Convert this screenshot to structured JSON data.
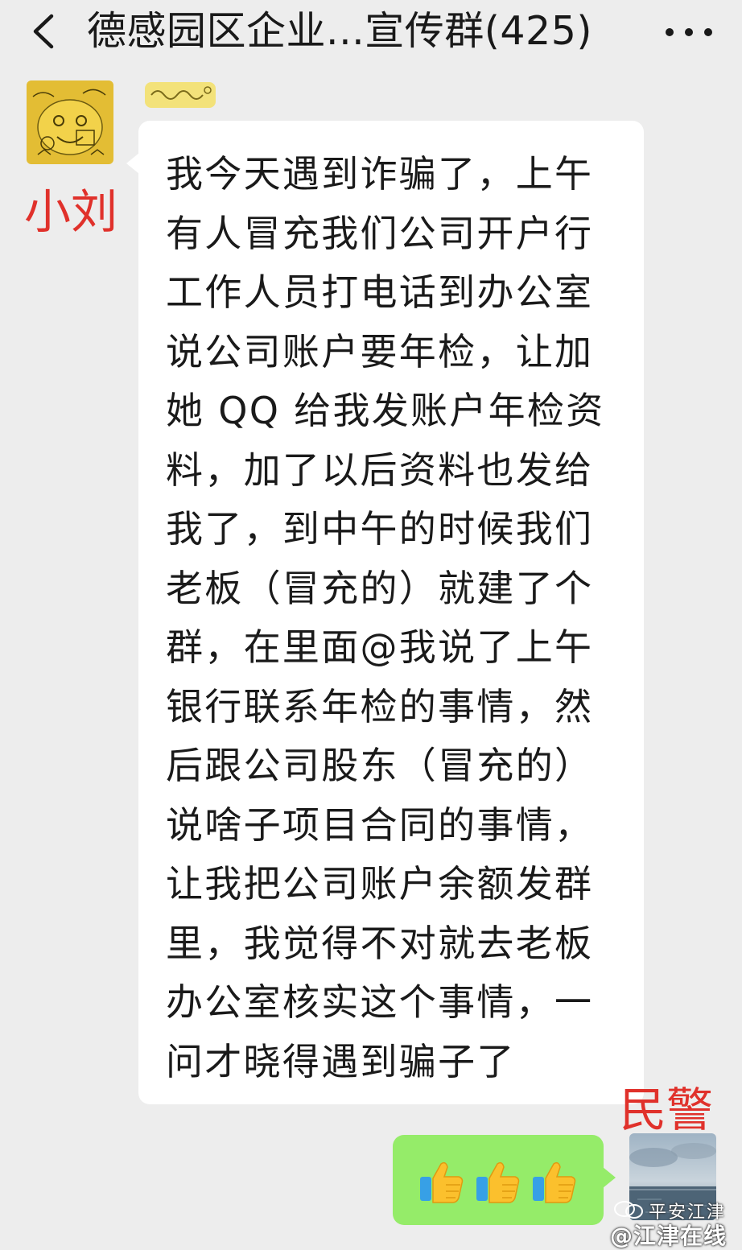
{
  "header": {
    "back_icon": "chevron-left-icon",
    "title": "德感园区企业...宣传群(425)",
    "more_icon": "ellipsis-icon"
  },
  "messages": [
    {
      "direction": "incoming",
      "sender_label": "小刘",
      "avatar": "cartoon-doodle-avatar",
      "text": "我今天遇到诈骗了，上午有人冒充我们公司开户行工作人员打电话到办公室说公司账户要年检，让加她 QQ 给我发账户年检资料，加了以后资料也发给我了，到中午的时候我们老板（冒充的）就建了个群，在里面@我说了上午银行联系年检的事情，然后跟公司股东（冒充的）说啥子项目合同的事情，让我把公司账户余额发群里，我觉得不对就去老板办公室核实这个事情，一问才晓得遇到骗子了"
    },
    {
      "direction": "outgoing",
      "sender_label": "民警",
      "avatar": "sea-sky-avatar",
      "emojis": [
        "thumbs-up-icon",
        "thumbs-up-icon",
        "thumbs-up-icon"
      ]
    }
  ],
  "watermark": {
    "line1": "平安江津",
    "line2": "@江津在线"
  },
  "colors": {
    "background": "#ededed",
    "incoming_bubble": "#ffffff",
    "outgoing_bubble": "#95ec69",
    "label_red": "#e0312b"
  }
}
